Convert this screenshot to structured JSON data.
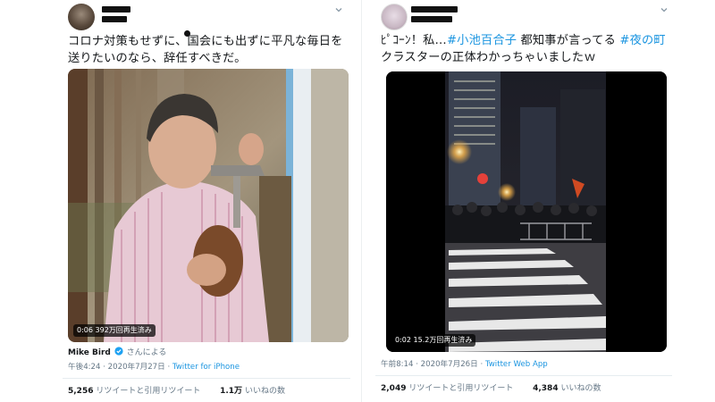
{
  "tweets": [
    {
      "text": "コロナ対策もせずに、国会にも出ずに平凡な毎日を送りたいのなら、辞任すべきだ。",
      "media": {
        "views": "392万回再生済み",
        "duration": "0:06"
      },
      "attribution": {
        "name": "Mike Bird",
        "suffix": "さんによる"
      },
      "timestamp": "午後4:24 · 2020年7月27日",
      "source": "Twitter for iPhone",
      "stats": {
        "retweets": "5,256",
        "retweets_label": "リツイートと引用リツイート",
        "likes": "1.1万",
        "likes_label": "いいねの数"
      }
    },
    {
      "text_prefix": "ﾋﾟｺｰﾝ！私…",
      "hashtag1": "#小池百合子",
      "text_middle": " 都知事が言ってる ",
      "hashtag2": "#夜の町",
      "text_suffix": " クラスターの正体わかっちゃいましたｗ",
      "media": {
        "views": "15.2万回再生済み",
        "duration": "0:02"
      },
      "timestamp": "午前8:14 · 2020年7月26日",
      "source": "Twitter Web App",
      "stats": {
        "retweets": "2,049",
        "retweets_label": "リツイートと引用リツイート",
        "likes": "4,384",
        "likes_label": "いいねの数"
      }
    }
  ],
  "colors": {
    "link": "#1b95e0",
    "muted": "#657786",
    "text": "#14171a"
  },
  "icons": [
    "chevron-down-icon",
    "verified-badge-icon"
  ]
}
